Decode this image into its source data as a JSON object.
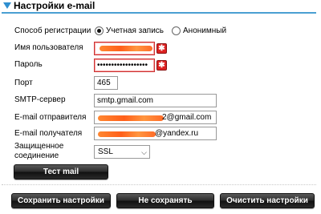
{
  "header": {
    "title": "Настройки e-mail"
  },
  "form": {
    "registration": {
      "label": "Способ регистрации",
      "option_account": "Учетная запись",
      "option_anonymous": "Анонимный",
      "selected": "Учетная запись"
    },
    "username": {
      "label": "Имя пользователя"
    },
    "password": {
      "label": "Пароль",
      "value": "••••••••••••••••••"
    },
    "port": {
      "label": "Порт",
      "value": "465"
    },
    "smtp": {
      "label": "SMTP-сервер",
      "value": "smtp.gmail.com"
    },
    "sender": {
      "label": "E-mail отправителя",
      "value_visible": "2@gmail.com"
    },
    "recipient": {
      "label": "E-mail получателя",
      "value_visible": "@yandex.ru"
    },
    "security": {
      "label_line1": "Защищенное",
      "label_line2": "соединение",
      "value": "SSL"
    }
  },
  "buttons": {
    "test_mail": "Тест mail",
    "save": "Сохранить настройки",
    "discard": "Не сохранять",
    "clear": "Очистить настройки"
  },
  "icons": {
    "header_toggle": "triangle-down-icon",
    "error": "error-icon"
  },
  "colors": {
    "accent": "#4a9fd2",
    "error": "#dd2222",
    "button": "#1a1a1a"
  }
}
